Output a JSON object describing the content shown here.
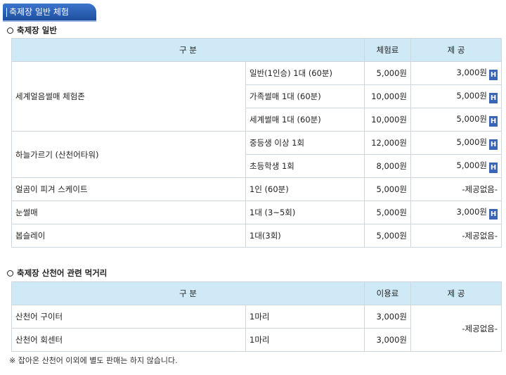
{
  "header": {
    "title": "축제장 일반 체험"
  },
  "section1": {
    "heading": "축제장 일반",
    "columns": [
      "구 분",
      "체험료",
      "제 공"
    ],
    "groups": [
      {
        "name": "세계얼음썰매 체험존",
        "rows": [
          {
            "item": "일반(1인승) 1대 (60분)",
            "fee": "5,000원",
            "provide": "3,000원",
            "badge": "H"
          },
          {
            "item": "가족썰매 1대 (60분)",
            "fee": "10,000원",
            "provide": "5,000원",
            "badge": "H"
          },
          {
            "item": "세계썰매 1대 (60분)",
            "fee": "10,000원",
            "provide": "5,000원",
            "badge": "H"
          }
        ]
      },
      {
        "name": "하늘가르기 (산천어타워)",
        "rows": [
          {
            "item": "중등생 이상 1회",
            "fee": "12,000원",
            "provide": "5,000원",
            "badge": "H"
          },
          {
            "item": "초등학생 1회",
            "fee": "8,000원",
            "provide": "5,000원",
            "badge": "H"
          }
        ]
      },
      {
        "name": "얼곰이 피겨 스케이트",
        "rows": [
          {
            "item": "1인 (60분)",
            "fee": "5,000원",
            "provide": "-제공없음-",
            "badge": ""
          }
        ]
      },
      {
        "name": "눈썰매",
        "rows": [
          {
            "item": "1대 (3~5회)",
            "fee": "5,000원",
            "provide": "3,000원",
            "badge": "H"
          }
        ]
      },
      {
        "name": "봅슬레이",
        "rows": [
          {
            "item": "1대(3회)",
            "fee": "5,000원",
            "provide": "-제공없음-",
            "badge": ""
          }
        ]
      }
    ]
  },
  "section2": {
    "heading": "축제장 산천어 관련 먹거리",
    "columns": [
      "구 분",
      "이용료",
      "제 공"
    ],
    "rows": [
      {
        "name": "산천어 구이터",
        "item": "1마리",
        "fee": "3,000원"
      },
      {
        "name": "산천어 회센터",
        "item": "1마리",
        "fee": "3,000원"
      }
    ],
    "provide": "-제공없음-"
  },
  "note": "※ 잡아온 산천어 이외에 별도 판매는 하지 않습니다."
}
